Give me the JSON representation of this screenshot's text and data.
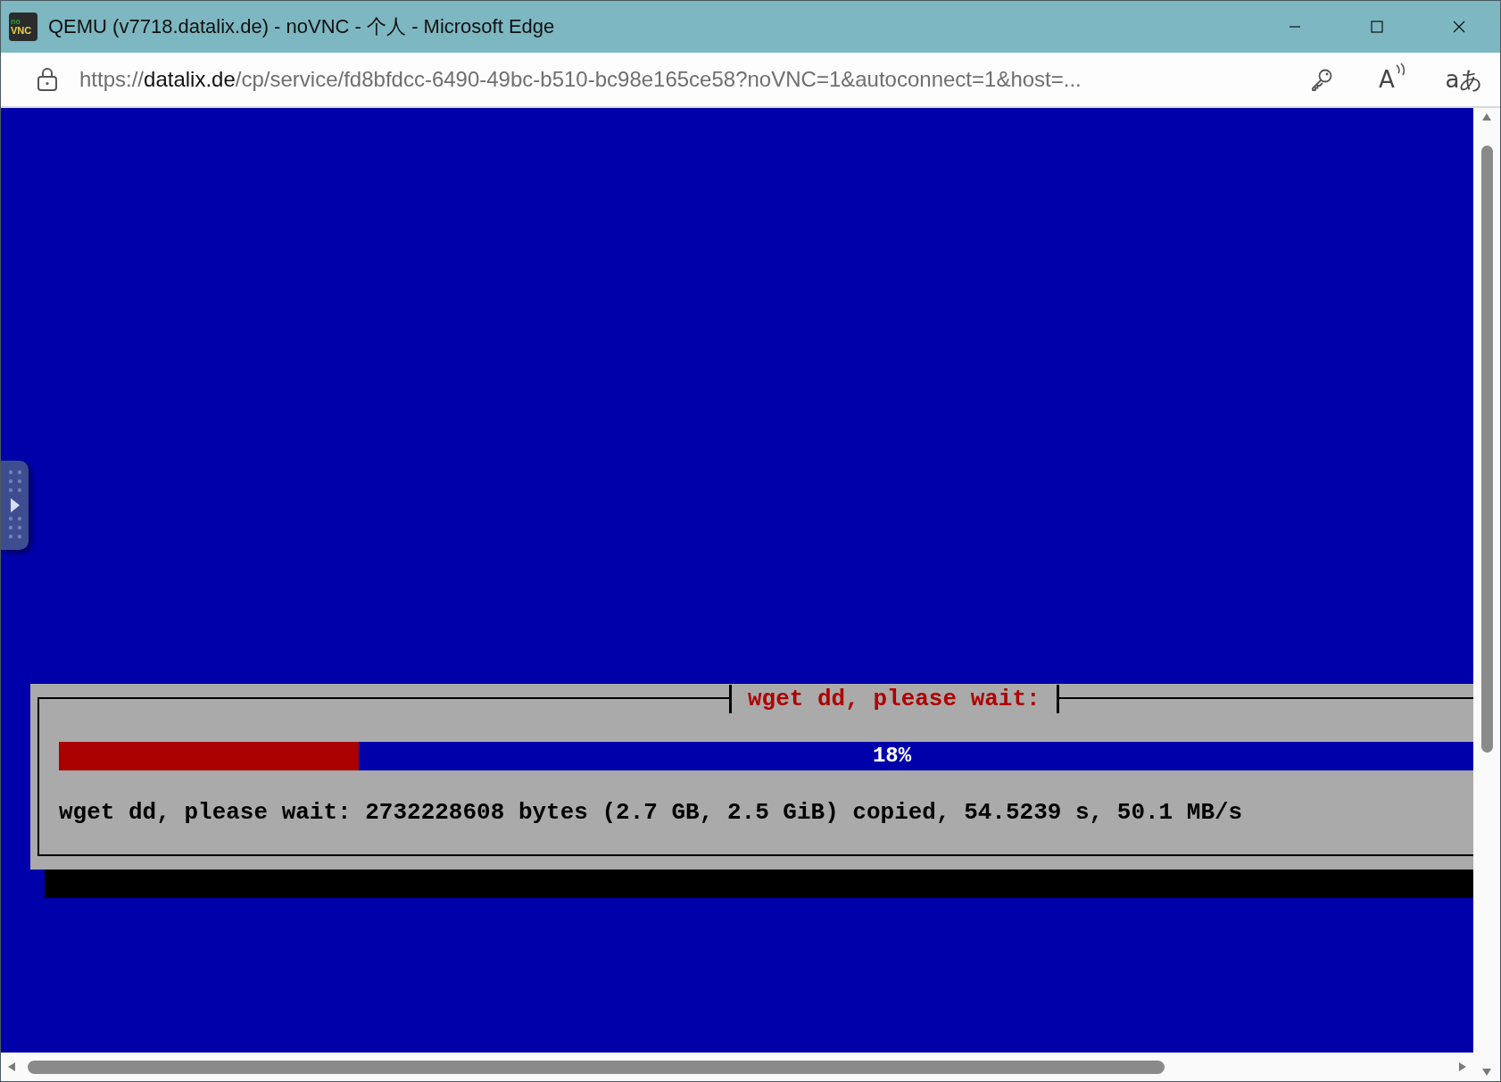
{
  "window": {
    "title": "QEMU (v7718.datalix.de) - noVNC - 个人 - Microsoft Edge",
    "logo_text": [
      "no",
      "VNC"
    ]
  },
  "address_bar": {
    "url_scheme": "https://",
    "url_domain": "datalix.de",
    "url_rest": "/cp/service/fd8bfdcc-6490-49bc-b510-bc98e165ce58?noVNC=1&autoconnect=1&host=...",
    "read_aloud_glyph": "A",
    "translate_glyph": "aあ"
  },
  "console": {
    "dialog_title": "wget dd, please wait:",
    "progress": {
      "level": 0.18,
      "label": "18%"
    },
    "status": "wget dd, please wait: 2732228608 bytes (2.7 GB, 2.5 GiB) copied, 54.5239 s, 50.1 MB/s"
  },
  "novnc_sidebar": {
    "expanded": false
  }
}
